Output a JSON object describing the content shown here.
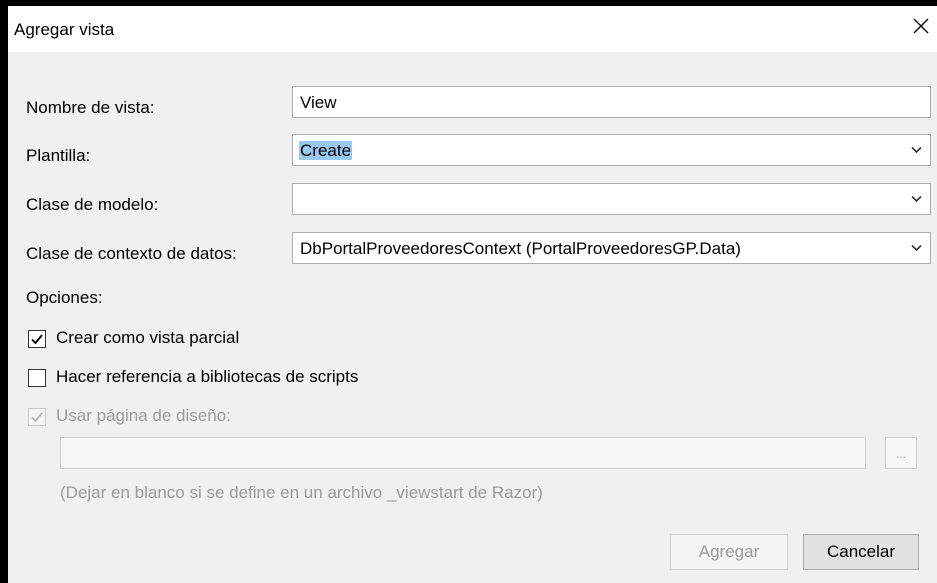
{
  "window": {
    "title": "Agregar vista",
    "close_icon": "close-icon"
  },
  "form": {
    "view_name": {
      "label": "Nombre de vista:",
      "value": "View"
    },
    "template": {
      "label": "Plantilla:",
      "value": "Create"
    },
    "model_class": {
      "label": "Clase de modelo:",
      "value": ""
    },
    "data_context_class": {
      "label": "Clase de contexto de datos:",
      "value": "DbPortalProveedoresContext (PortalProveedoresGP.Data)"
    }
  },
  "options": {
    "heading": "Opciones:",
    "partial_view": {
      "label": "Crear como vista parcial",
      "checked": true
    },
    "script_libraries": {
      "label": "Hacer referencia a bibliotecas de scripts",
      "checked": false
    },
    "layout_page": {
      "label": "Usar página de diseño:",
      "checked": true,
      "disabled": true,
      "value": ""
    },
    "browse_label": "...",
    "hint": "(Dejar en blanco si se define en un archivo _viewstart de Razor)"
  },
  "buttons": {
    "add": "Agregar",
    "cancel": "Cancelar"
  },
  "colors": {
    "dialog_bg": "#f0f0f0",
    "selection": "#9ac9ef",
    "disabled_text": "#9a9a9a"
  }
}
